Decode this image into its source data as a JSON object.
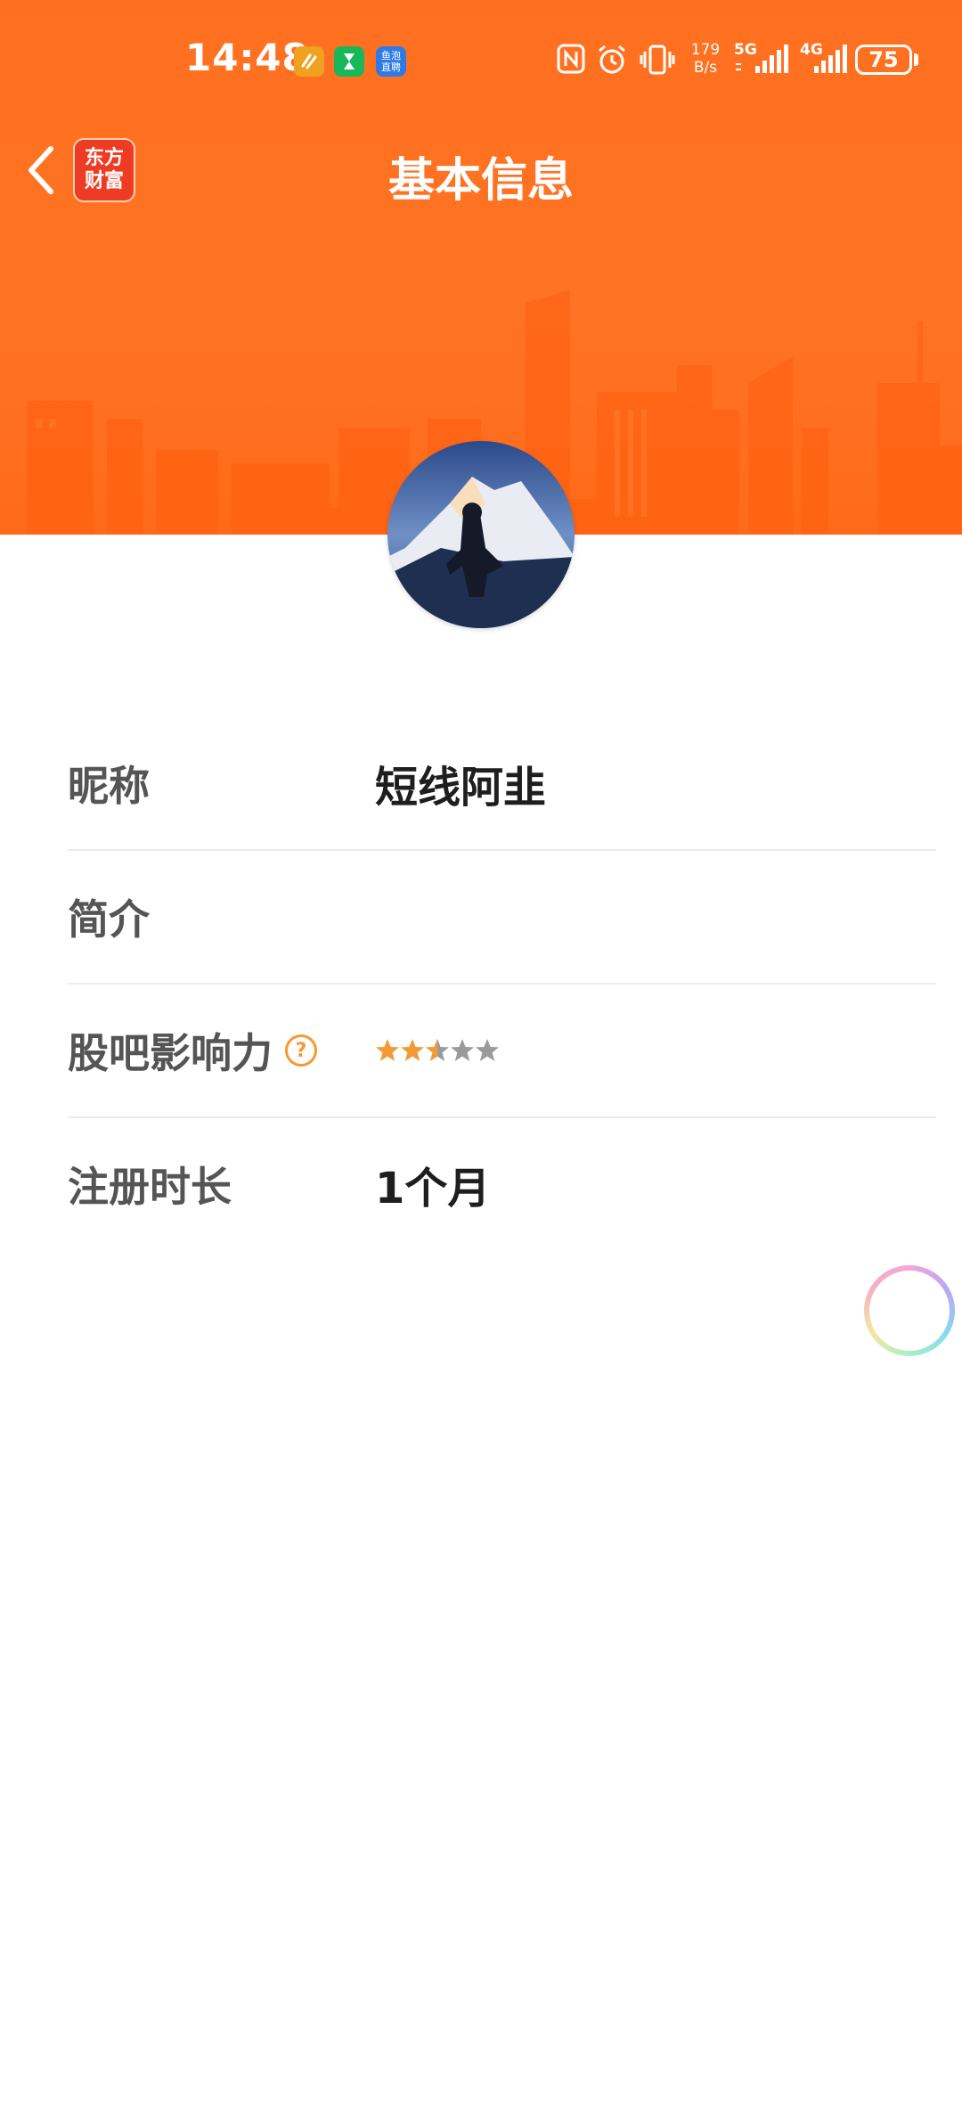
{
  "status_bar": {
    "time": "14:48",
    "app_badges": [
      {
        "name": "app-badge-1",
        "color": "#f0a11f",
        "glyph": "⟋"
      },
      {
        "name": "app-badge-2",
        "color": "#18b75a",
        "glyph": "⌛"
      },
      {
        "name": "app-badge-3",
        "color": "#2f7be5",
        "glyph": "鱼泡"
      }
    ],
    "net_speed_value": "179",
    "net_speed_unit": "B/s",
    "sim1_label": "5G",
    "sim2_label": "4G",
    "battery": "75"
  },
  "nav": {
    "title": "基本信息",
    "logo_line1": "东方",
    "logo_line2": "财富"
  },
  "profile": {
    "rows": [
      {
        "label": "昵称",
        "value": "短线阿韭"
      },
      {
        "label": "简介",
        "value": ""
      },
      {
        "label": "股吧影响力",
        "help": "?",
        "stars_filled": 2.5,
        "stars_total": 5
      },
      {
        "label": "注册时长",
        "value": "1个月"
      }
    ]
  },
  "colors": {
    "banner_orange": "#ff6f1f",
    "star_filled": "#f29a34",
    "star_empty": "#9a9a9a",
    "label_gray": "#555555",
    "value_black": "#1e1e1e"
  }
}
